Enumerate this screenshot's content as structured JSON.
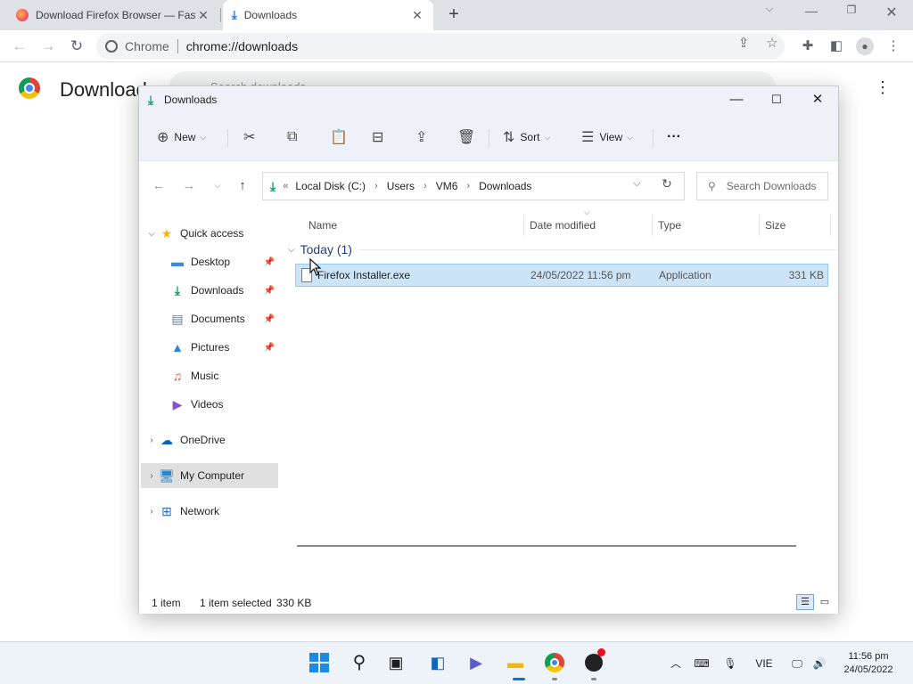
{
  "browser": {
    "tabs": [
      {
        "title": "Download Firefox Browser — Fast, Private & Free — from Mozilla",
        "active": false,
        "icon": "firefox-icon"
      },
      {
        "title": "Downloads",
        "active": true,
        "icon": "download-icon"
      }
    ],
    "new_tab": "+",
    "omnibox": {
      "site_label": "Chrome",
      "url": "chrome://downloads"
    },
    "downloads_page": {
      "title": "Downloads",
      "search_placeholder": "Search downloads"
    }
  },
  "explorer": {
    "title": "Downloads",
    "commands": {
      "new_label": "New",
      "sort_label": "Sort",
      "view_label": "View",
      "more_label": "···"
    },
    "address": {
      "overflow": "«",
      "crumbs": [
        "Local Disk (C:)",
        "Users",
        "VM6",
        "Downloads"
      ],
      "search_placeholder": "Search Downloads"
    },
    "nav": {
      "quick_access": "Quick access",
      "items": [
        {
          "label": "Desktop",
          "icon": "desktop-icon",
          "pinned": true
        },
        {
          "label": "Downloads",
          "icon": "download-icon",
          "pinned": true
        },
        {
          "label": "Documents",
          "icon": "documents-icon",
          "pinned": true
        },
        {
          "label": "Pictures",
          "icon": "pictures-icon",
          "pinned": true
        },
        {
          "label": "Music",
          "icon": "music-icon",
          "pinned": false
        },
        {
          "label": "Videos",
          "icon": "videos-icon",
          "pinned": false
        }
      ],
      "onedrive": "OneDrive",
      "my_computer": "My Computer",
      "network": "Network"
    },
    "columns": {
      "name": "Name",
      "date": "Date modified",
      "type": "Type",
      "size": "Size"
    },
    "group": {
      "label": "Today (1)"
    },
    "files": [
      {
        "name": "Firefox Installer.exe",
        "date": "24/05/2022 11:56 pm",
        "type": "Application",
        "size": "331 KB"
      }
    ],
    "status": {
      "count": "1 item",
      "selected": "1 item selected",
      "selected_size": "330 KB"
    }
  },
  "taskbar": {
    "tray": {
      "lang": "VIE"
    },
    "clock": {
      "time": "11:56 pm",
      "date": "24/05/2022"
    }
  },
  "colors": {
    "accent": "#0078d4",
    "selection": "#cce4f7",
    "download_green": "#0f9b6e"
  }
}
